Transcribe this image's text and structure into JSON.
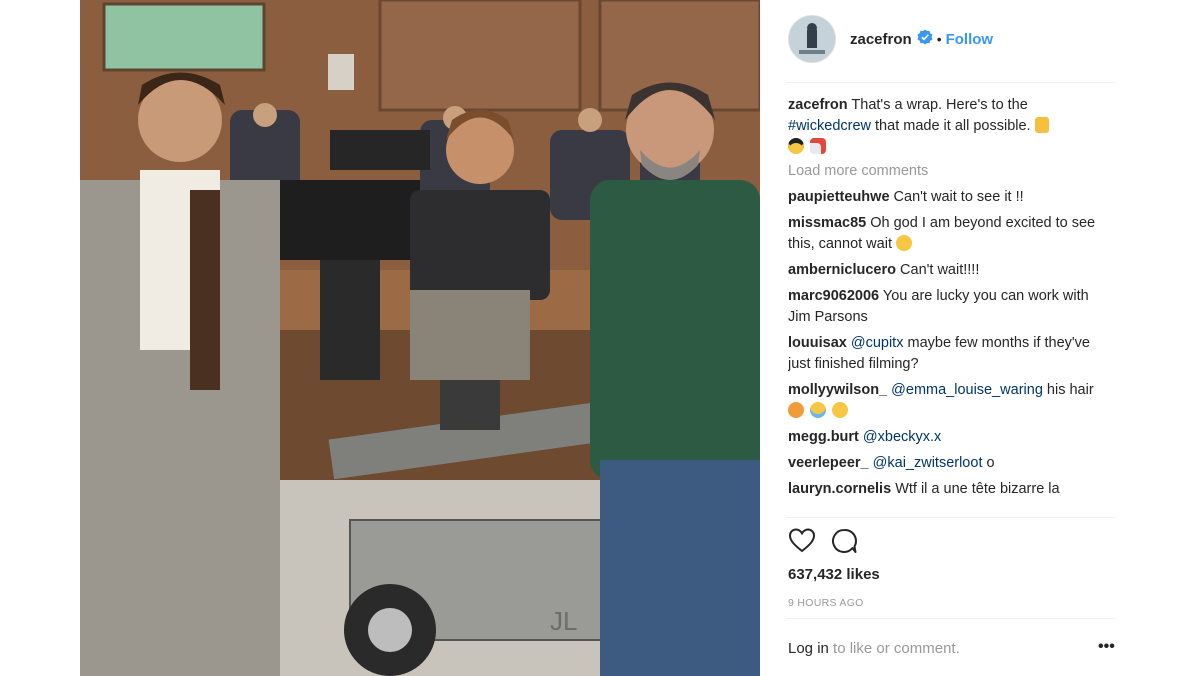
{
  "post": {
    "username": "zacefron",
    "dot": "•",
    "follow_label": "Follow",
    "caption_user": "zacefron",
    "caption_text": "That's a wrap. Here's to the",
    "caption_hashtag": "#wickedcrew",
    "caption_rest": "that made it all possible.",
    "load_more": "Load more comments",
    "comments": [
      {
        "user": "paupietteuhwe",
        "text": "Can't wait to see it !!"
      },
      {
        "user": "missmac85",
        "text": "Oh god I am beyond excited to see this, cannot wait"
      },
      {
        "user": "amberniclucero",
        "text": "Can't wait!!!!"
      },
      {
        "user": "marc9062006",
        "text": "You are lucky you can work with Jim Parsons"
      },
      {
        "user": "louuisax",
        "mention": "@cupitx",
        "text": "maybe few months if they've just finished filming?"
      },
      {
        "user": "mollyywilson_",
        "mention": "@emma_louise_waring",
        "text": "his hair"
      },
      {
        "user": "megg.burt",
        "mention": "@xbeckyx.x",
        "text": ""
      },
      {
        "user": "veerlepeer_",
        "mention": "@kai_zwitserloot",
        "text": "o"
      },
      {
        "user": "lauryn.cornelis",
        "text": "Wtf il a une tête bizarre la"
      }
    ],
    "likes": "637,432 likes",
    "time": "9 HOURS AGO",
    "login_link": "Log in",
    "login_text": "to like or comment.",
    "more_label": "•••",
    "photo_sign": "JL"
  },
  "icons": {
    "verified": "verified-badge-icon",
    "like": "heart-icon",
    "comment": "comment-bubble-icon",
    "emoji_pray": "praying-hands-emoji",
    "emoji_cool": "sunglasses-emoji",
    "emoji_rocket": "rocket-emoji"
  },
  "colors": {
    "link_blue": "#3897f0",
    "tag_blue": "#003569",
    "muted": "#999999",
    "text": "#262626"
  }
}
